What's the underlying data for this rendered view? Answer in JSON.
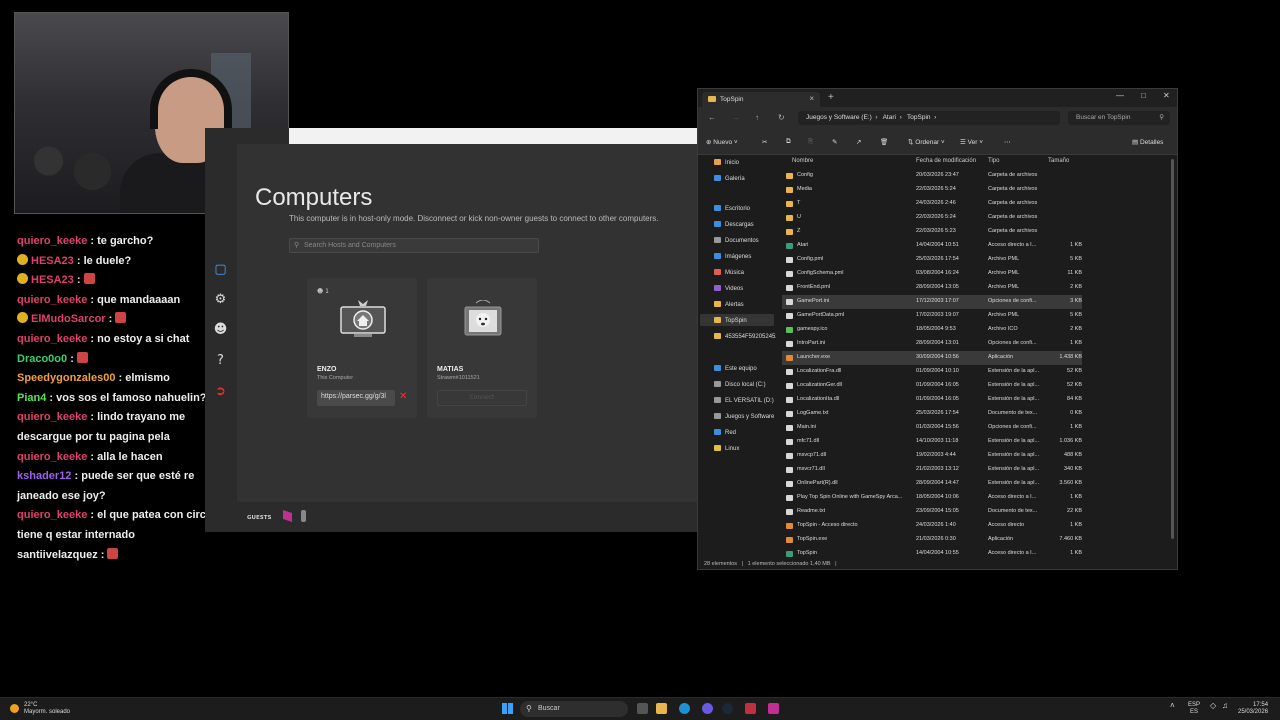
{
  "chat": [
    {
      "user": "quiero_keeke",
      "color": "#e0406a",
      "text": "te garcho?"
    },
    {
      "user": "HESA23",
      "color": "#e0406a",
      "badge": "#e0b020",
      "text": "le duele?"
    },
    {
      "user": "HESA23",
      "color": "#e0406a",
      "badge": "#e0b020",
      "text": "",
      "emote": true
    },
    {
      "user": "quiero_keeke",
      "color": "#e0406a",
      "text": "que mandaaaan"
    },
    {
      "user": "ElMudoSarcor",
      "color": "#e0406a",
      "badge": "#e0b020",
      "text": "",
      "emote": true
    },
    {
      "user": "quiero_keeke",
      "color": "#e0406a",
      "text": "no estoy a si chat"
    },
    {
      "user": "Draco0o0",
      "color": "#3ad16a",
      "text": "",
      "emote": true
    },
    {
      "user": "Speedygonzales00",
      "color": "#f0a040",
      "text": "elmismo"
    },
    {
      "user": "Pian4",
      "color": "#5be05b",
      "text": "vos sos el famoso nahuelin?"
    },
    {
      "user": "quiero_keeke",
      "color": "#e0406a",
      "text": "lindo trayano me descargue por tu pagina pela"
    },
    {
      "user": "quiero_keeke",
      "color": "#e0406a",
      "text": "alla le hacen"
    },
    {
      "user": "kshader12",
      "color": "#a060f0",
      "text": "puede ser que esté re janeado ese joy?"
    },
    {
      "user": "quiero_keeke",
      "color": "#e0406a",
      "text": "el que patea con circulo tiene q estar internado"
    },
    {
      "user": "santiivelazquez",
      "color": "#eeeeee",
      "text": "",
      "emote": true
    }
  ],
  "parsec": {
    "title": "Computers",
    "subtitle": "This computer is in host-only mode. Disconnect or kick non-owner guests to connect to other computers.",
    "search_placeholder": "Search Hosts and Computers",
    "cards": [
      {
        "count": "1",
        "name": "ENZO",
        "sub": "This Computer",
        "link": "https://parsec.gg/g/3l"
      },
      {
        "name": "MATIAS",
        "sub": "Strawm#1011521",
        "button": "Connect"
      }
    ],
    "guests_label": "GUESTS"
  },
  "explorer": {
    "tab_title": "TopSpin",
    "breadcrumb": [
      "Juegos y Software (E:)",
      "Atari",
      "TopSpin"
    ],
    "search_placeholder": "Buscar en TopSpin",
    "toolbar": {
      "new": "Nuevo",
      "sort": "Ordenar",
      "view": "Ver",
      "details": "Detalles"
    },
    "nav": [
      {
        "label": "Inicio",
        "color": "#e8a050"
      },
      {
        "label": "Galería",
        "color": "#3d8ee0"
      },
      {
        "label": "Escritorio",
        "color": "#3d8ee0"
      },
      {
        "label": "Descargas",
        "color": "#3d8ee0"
      },
      {
        "label": "Documentos",
        "color": "#999"
      },
      {
        "label": "Imágenes",
        "color": "#3d8ee0"
      },
      {
        "label": "Música",
        "color": "#e06050"
      },
      {
        "label": "Videos",
        "color": "#9060d0"
      },
      {
        "label": "Alertas",
        "color": "#e8b64c"
      },
      {
        "label": "TopSpin",
        "color": "#e8b64c"
      },
      {
        "label": "453554F592052452",
        "color": "#e8b64c"
      },
      {
        "label": "Este equipo",
        "color": "#3d8ee0"
      },
      {
        "label": "Disco local (C:)",
        "color": "#999"
      },
      {
        "label": "EL VERSATIL (D:)",
        "color": "#999"
      },
      {
        "label": "Juegos y Software",
        "color": "#999"
      },
      {
        "label": "Red",
        "color": "#3d8ee0"
      },
      {
        "label": "Linux",
        "color": "#e0c040"
      }
    ],
    "columns": [
      "Nombre",
      "Fecha de modificación",
      "Tipo",
      "Tamaño"
    ],
    "files": [
      {
        "name": "Config",
        "date": "20/03/2026 23:47",
        "type": "Carpeta de archivos",
        "size": "",
        "kind": "folder"
      },
      {
        "name": "Media",
        "date": "22/03/2026 5:24",
        "type": "Carpeta de archivos",
        "size": "",
        "kind": "folder"
      },
      {
        "name": "T",
        "date": "24/03/2026 2:46",
        "type": "Carpeta de archivos",
        "size": "",
        "kind": "folder"
      },
      {
        "name": "U",
        "date": "22/03/2026 5:24",
        "type": "Carpeta de archivos",
        "size": "",
        "kind": "folder"
      },
      {
        "name": "Z",
        "date": "22/03/2026 5:23",
        "type": "Carpeta de archivos",
        "size": "",
        "kind": "folder"
      },
      {
        "name": "Atari",
        "date": "14/04/2004 10:51",
        "type": "Acceso directo a I...",
        "size": "1 KB",
        "kind": "link"
      },
      {
        "name": "Config.pml",
        "date": "25/03/2026 17:54",
        "type": "Archivo PML",
        "size": "5 KB",
        "kind": "file"
      },
      {
        "name": "ConfigSchema.pml",
        "date": "03/08/2004 16:24",
        "type": "Archivo PML",
        "size": "11 KB",
        "kind": "file"
      },
      {
        "name": "FrontEnd.pml",
        "date": "28/09/2004 13:05",
        "type": "Archivo PML",
        "size": "2 KB",
        "kind": "file"
      },
      {
        "name": "GamePort.ini",
        "date": "17/12/2003 17:07",
        "type": "Opciones de confi...",
        "size": "3 KB",
        "kind": "file",
        "selected": true
      },
      {
        "name": "GamePortData.pml",
        "date": "17/02/2003 19:07",
        "type": "Archivo PML",
        "size": "5 KB",
        "kind": "file"
      },
      {
        "name": "gamespy.ico",
        "date": "18/05/2004 9:53",
        "type": "Archivo ICO",
        "size": "2 KB",
        "kind": "ico"
      },
      {
        "name": "IntroPart.ini",
        "date": "28/09/2004 13:01",
        "type": "Opciones de confi...",
        "size": "1 KB",
        "kind": "file"
      },
      {
        "name": "Launcher.exe",
        "date": "30/09/2004 10:56",
        "type": "Aplicación",
        "size": "1.438 KB",
        "kind": "exe",
        "selected": true
      },
      {
        "name": "LocalizationFra.dll",
        "date": "01/09/2004 10:10",
        "type": "Extensión de la apl...",
        "size": "52 KB",
        "kind": "file"
      },
      {
        "name": "LocalizationGer.dll",
        "date": "01/09/2004 16:05",
        "type": "Extensión de la apl...",
        "size": "52 KB",
        "kind": "file"
      },
      {
        "name": "LocalizationIta.dll",
        "date": "01/09/2004 16:05",
        "type": "Extensión de la apl...",
        "size": "84 KB",
        "kind": "file"
      },
      {
        "name": "LogGame.txt",
        "date": "25/03/2026 17:54",
        "type": "Documento de tex...",
        "size": "0 KB",
        "kind": "file"
      },
      {
        "name": "Main.ini",
        "date": "01/03/2004 15:56",
        "type": "Opciones de confi...",
        "size": "1 KB",
        "kind": "file"
      },
      {
        "name": "mfc71.dll",
        "date": "14/10/2003 11:18",
        "type": "Extensión de la apl...",
        "size": "1.036 KB",
        "kind": "file"
      },
      {
        "name": "msvcp71.dll",
        "date": "19/02/2003 4:44",
        "type": "Extensión de la apl...",
        "size": "488 KB",
        "kind": "file"
      },
      {
        "name": "msvcr71.dll",
        "date": "21/02/2003 13:12",
        "type": "Extensión de la apl...",
        "size": "340 KB",
        "kind": "file"
      },
      {
        "name": "OnlinePart(R).dll",
        "date": "28/09/2004 14:47",
        "type": "Extensión de la apl...",
        "size": "3.560 KB",
        "kind": "file"
      },
      {
        "name": "Play Top Spin Online with GameSpy Arca...",
        "date": "18/05/2004 10:06",
        "type": "Acceso directo a I...",
        "size": "1 KB",
        "kind": "file"
      },
      {
        "name": "Readme.txt",
        "date": "23/09/2004 15:05",
        "type": "Documento de tex...",
        "size": "22 KB",
        "kind": "file"
      },
      {
        "name": "TopSpin - Acceso directo",
        "date": "24/03/2026 1:40",
        "type": "Acceso directo",
        "size": "1 KB",
        "kind": "exe"
      },
      {
        "name": "TopSpin.exe",
        "date": "21/03/2026 0:30",
        "type": "Aplicación",
        "size": "7.460 KB",
        "kind": "exe"
      },
      {
        "name": "TopSpin",
        "date": "14/04/2004 10:55",
        "type": "Acceso directo a I...",
        "size": "1 KB",
        "kind": "link"
      }
    ],
    "status": {
      "count": "28 elementos",
      "selected": "1 elemento seleccionado  1,40 MB"
    }
  },
  "taskbar": {
    "temp": "22°C",
    "weather": "Mayorm. soleado",
    "search": "Buscar",
    "lang": "ESP",
    "region": "ES",
    "time": "17:54",
    "date": "25/03/2026"
  },
  "colors": {
    "folder": "#e8b64c",
    "accent": "#3d8ee0",
    "parsec_red": "#e33"
  }
}
